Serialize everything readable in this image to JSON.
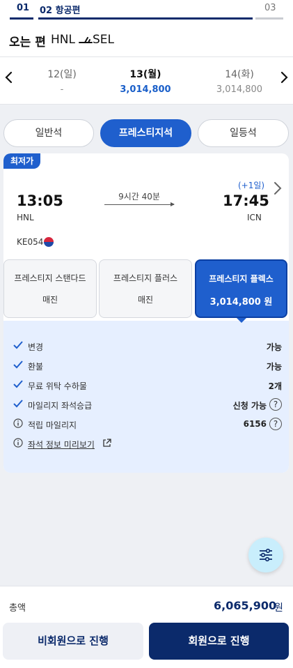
{
  "steps": {
    "s1": "01",
    "s2": "02  항공편",
    "s3": "03"
  },
  "route": {
    "title": "오는 편",
    "from": "HNL",
    "to": "SEL"
  },
  "dates": [
    {
      "date": "12(일)",
      "price": "-"
    },
    {
      "date": "13(월)",
      "price": "3,014,800"
    },
    {
      "date": "14(화)",
      "price": "3,014,800"
    }
  ],
  "cabin_tabs": [
    "일반석",
    "프레스티지석",
    "일등석"
  ],
  "selected_cabin": "프레스티지석",
  "flight": {
    "badge": "최저가",
    "dep_time": "13:05",
    "dep_code": "HNL",
    "duration": "9시간 40분",
    "next_day": "(+1일)",
    "arr_time": "17:45",
    "arr_code": "ICN",
    "flight_no": "KE054"
  },
  "fares": [
    {
      "name": "프레스티지 스탠다드",
      "value": "매진"
    },
    {
      "name": "프레스티지 플러스",
      "value": "매진"
    },
    {
      "name": "프레스티지 플렉스",
      "value": "3,014,800 원"
    }
  ],
  "benefits": [
    {
      "label": "변경",
      "value": "가능",
      "icon": "check-icon"
    },
    {
      "label": "환불",
      "value": "가능",
      "icon": "check-icon"
    },
    {
      "label": "무료 위탁 수하물",
      "value": "2개",
      "icon": "check-icon"
    },
    {
      "label": "마일리지 좌석승급",
      "value": "신청 가능",
      "icon": "check-icon"
    },
    {
      "label": "적립 마일리지",
      "value": "6156",
      "icon": "info-icon"
    },
    {
      "label": "좌석 정보 미리보기",
      "icon": "info-icon"
    }
  ],
  "help_icon_text": "?",
  "total": {
    "label": "총액",
    "value": "6,065,900",
    "unit": "원"
  },
  "buttons": {
    "guest": "비회원으로 진행",
    "member": "회원으로 진행"
  },
  "colors": {
    "primary": "#1f5fcd",
    "navy": "#0b2a6b",
    "benefit_bg": "#e6efff",
    "fab_bg": "#c9eefc"
  }
}
